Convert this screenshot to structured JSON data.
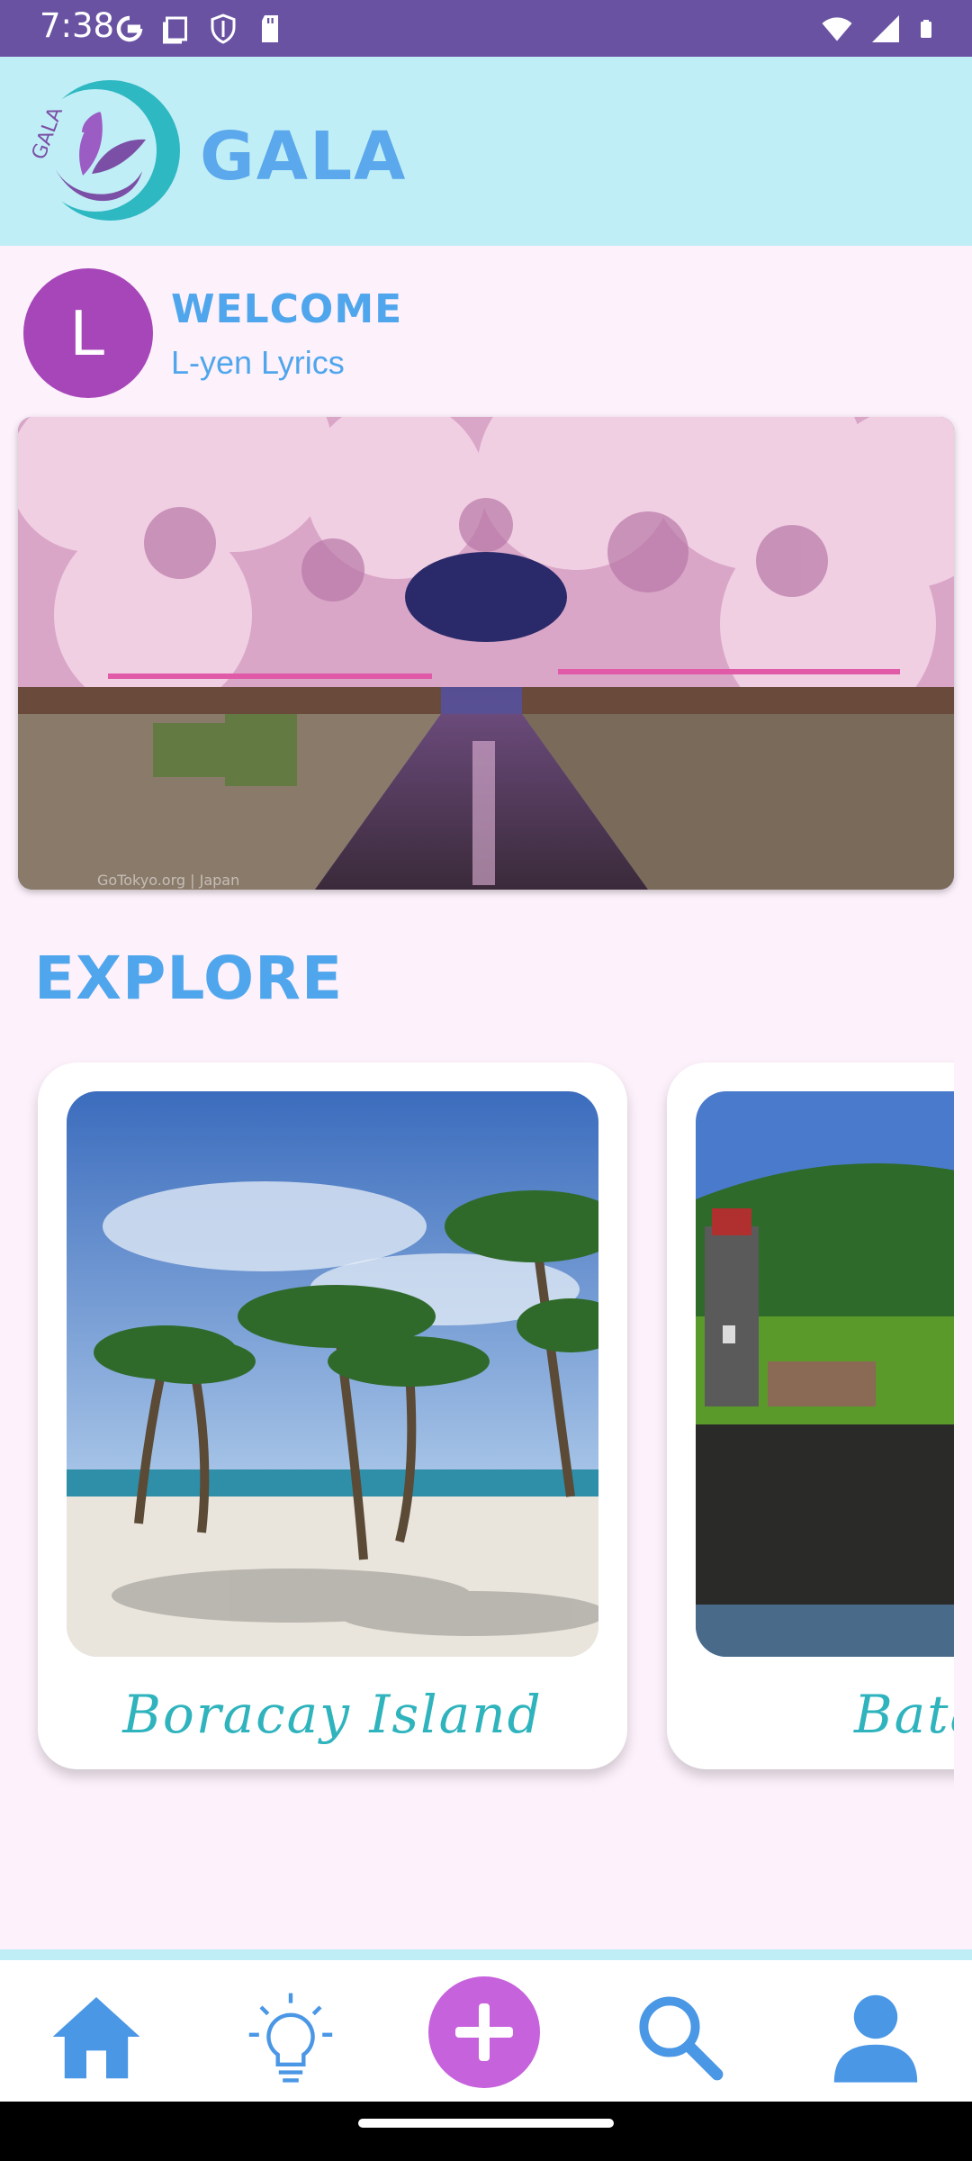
{
  "status_bar": {
    "time": "7:38",
    "icons_left": [
      "google-icon",
      "screenshot-icon",
      "shield-icon",
      "sdcard-icon"
    ],
    "icons_right": [
      "wifi-icon",
      "signal-icon",
      "battery-icon"
    ]
  },
  "header": {
    "logo_text": "GALA",
    "app_name": "GALA"
  },
  "welcome": {
    "avatar_letter": "L",
    "greeting": "WELCOME",
    "user_name": "L-yen Lyrics"
  },
  "hero": {
    "image": "cherry-blossom-canal-photo",
    "watermark": "GoTokyo.org | Japan"
  },
  "explore": {
    "heading": "EXPLORE",
    "cards": [
      {
        "title": "Boracay Island",
        "image": "beach-palm-trees-photo"
      },
      {
        "title": "Bata",
        "image": "lighthouse-cliff-photo"
      }
    ]
  },
  "bottom_nav": {
    "items": [
      "home-icon",
      "lightbulb-icon",
      "add-icon",
      "search-icon",
      "profile-icon"
    ]
  },
  "colors": {
    "status_bar": "#6a52a3",
    "header_bg": "#c0eef6",
    "accent_blue": "#4fa6ec",
    "avatar": "#a646b9",
    "fab": "#c762dd",
    "card_title": "#2fb3bd"
  }
}
